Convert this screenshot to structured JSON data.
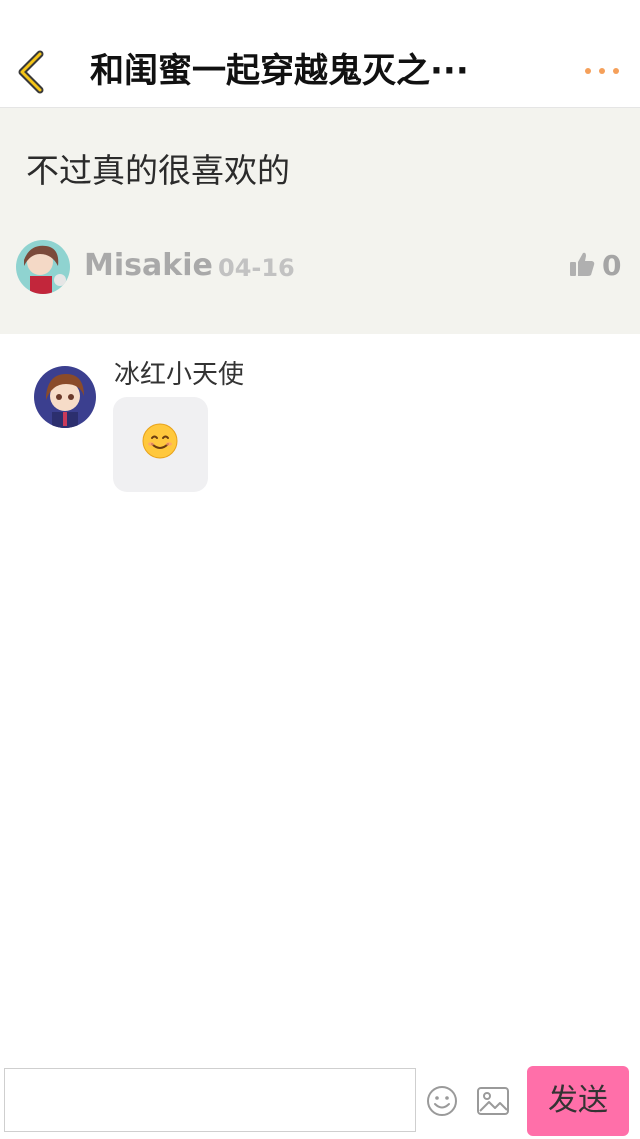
{
  "header": {
    "title": "和闺蜜一起穿越鬼灭之···",
    "back_icon": "chevron-left-icon",
    "more_icon": "more-dots-icon",
    "accent_color": "#f5a623"
  },
  "quote": {
    "text": "不过真的很喜欢的",
    "user": "Misakie",
    "date": "04-16",
    "like_count": "0",
    "background": "#f3f3ee"
  },
  "reply": {
    "user": "冰红小天使",
    "emoji_icon": "smiling-face-icon"
  },
  "composer": {
    "input_value": "",
    "input_placeholder": "",
    "emoji_icon": "emoji-icon",
    "image_icon": "image-icon",
    "send_label": "发送",
    "send_color": "#ff6fa9"
  }
}
